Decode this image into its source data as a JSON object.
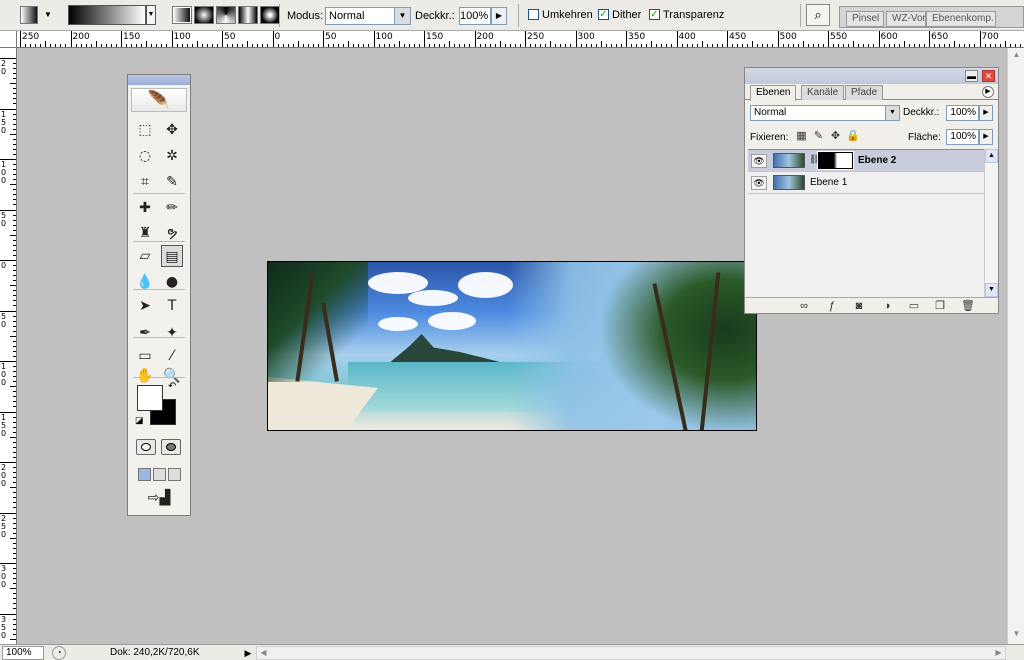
{
  "options_bar": {
    "mode_label": "Modus:",
    "mode_value": "Normal",
    "opacity_label": "Deckkr.:",
    "opacity_value": "100%",
    "reverse_label": "Umkehren",
    "reverse_checked": false,
    "dither_label": "Dither",
    "dither_checked": true,
    "transparency_label": "Transparenz",
    "transparency_checked": true,
    "gradient_types": [
      "linear",
      "radial",
      "angle",
      "reflected",
      "diamond"
    ]
  },
  "palette_well": {
    "tabs": [
      "Pinsel",
      "WZ-Vor",
      "Ebenenkomp."
    ]
  },
  "rulers": {
    "h_labels": [
      "250",
      "200",
      "150",
      "100",
      "50",
      "0",
      "50",
      "100",
      "150",
      "200",
      "250",
      "300",
      "350",
      "400",
      "450",
      "500",
      "550",
      "600",
      "650",
      "700"
    ],
    "v_labels": [
      "2\n0",
      "1\n5\n0",
      "1\n0\n0",
      "5\n0",
      "0",
      "5\n0",
      "1\n0\n0",
      "1\n5\n0",
      "2\n0\n0",
      "2\n5\n0",
      "3\n0\n0",
      "3\n5\n0"
    ]
  },
  "toolbox": {
    "tools": [
      {
        "name": "marquee-tool",
        "glyph": "⬚"
      },
      {
        "name": "move-tool",
        "glyph": "✥"
      },
      {
        "name": "lasso-tool",
        "glyph": "◌"
      },
      {
        "name": "magic-wand-tool",
        "glyph": "✲"
      },
      {
        "name": "crop-tool",
        "glyph": "⌗"
      },
      {
        "name": "slice-tool",
        "glyph": "✎"
      },
      {
        "name": "healing-brush-tool",
        "glyph": "✚"
      },
      {
        "name": "brush-tool",
        "glyph": "✏"
      },
      {
        "name": "clone-stamp-tool",
        "glyph": "♜"
      },
      {
        "name": "history-brush-tool",
        "glyph": "ຯ"
      },
      {
        "name": "eraser-tool",
        "glyph": "▱"
      },
      {
        "name": "gradient-tool",
        "glyph": "▤"
      },
      {
        "name": "blur-tool",
        "glyph": "💧"
      },
      {
        "name": "dodge-tool",
        "glyph": "●"
      },
      {
        "name": "path-selection-tool",
        "glyph": "➤"
      },
      {
        "name": "type-tool",
        "glyph": "T"
      },
      {
        "name": "pen-tool",
        "glyph": "✒"
      },
      {
        "name": "custom-shape-tool",
        "glyph": "✦"
      },
      {
        "name": "notes-tool",
        "glyph": "▭"
      },
      {
        "name": "eyedropper-tool",
        "glyph": "⁄"
      },
      {
        "name": "hand-tool",
        "glyph": "✋"
      },
      {
        "name": "zoom-tool",
        "glyph": "🔍"
      }
    ],
    "foreground_color": "#ffffff",
    "background_color": "#000000"
  },
  "layers_panel": {
    "tabs": [
      "Ebenen",
      "Kanäle",
      "Pfade"
    ],
    "active_tab": "Ebenen",
    "blend_mode": "Normal",
    "opacity_label": "Deckkr.:",
    "opacity_value": "100%",
    "lock_label": "Fixieren:",
    "fill_label": "Fläche:",
    "fill_value": "100%",
    "layers": [
      {
        "name": "Ebene 2",
        "selected": true,
        "has_mask": true,
        "visible": true
      },
      {
        "name": "Ebene 1",
        "selected": false,
        "has_mask": false,
        "visible": true
      }
    ],
    "bottom_buttons": [
      "link-layers",
      "add-layer-style",
      "add-layer-mask",
      "new-fill-adjustment-layer",
      "new-group",
      "new-layer",
      "delete-layer"
    ]
  },
  "status_bar": {
    "zoom": "100%",
    "doc_info": "Dok: 240,2K/720,6K"
  }
}
